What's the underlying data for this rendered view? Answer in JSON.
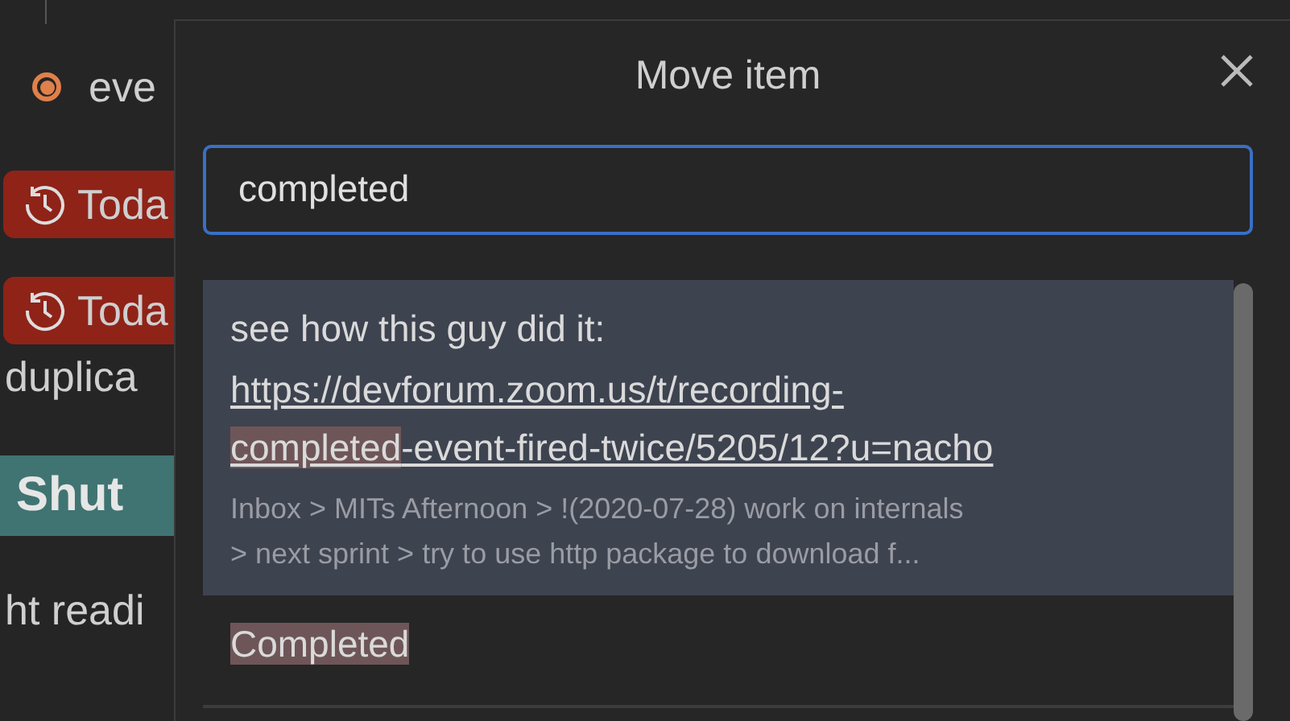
{
  "background_notes": [
    {
      "kind": "bullet",
      "text": "eve"
    },
    {
      "kind": "due_badge",
      "text": "Toda"
    },
    {
      "kind": "due_badge",
      "text": "Toda"
    },
    {
      "kind": "text",
      "text": "duplica"
    },
    {
      "kind": "heading",
      "text": "Shut"
    },
    {
      "kind": "text",
      "text": "ht readi"
    }
  ],
  "dialog": {
    "title": "Move item",
    "search": {
      "value": "completed",
      "focused": true
    },
    "results": [
      {
        "selected": true,
        "title": [
          {
            "text": "see how this guy did it:",
            "match": false
          }
        ],
        "link": [
          {
            "text": "https://devforum.zoom.us/t/recording-",
            "match": false
          },
          {
            "text": "completed",
            "match": true
          },
          {
            "text": "-event-fired-twice/5205/12?u=nacho",
            "match": false
          }
        ],
        "path": "Inbox > MITs Afternoon > !(2020-07-28) work on internals > next sprint > try to use http package to download f..."
      },
      {
        "selected": false,
        "title": [
          {
            "text": "Completed",
            "match": true
          }
        ]
      }
    ]
  }
}
